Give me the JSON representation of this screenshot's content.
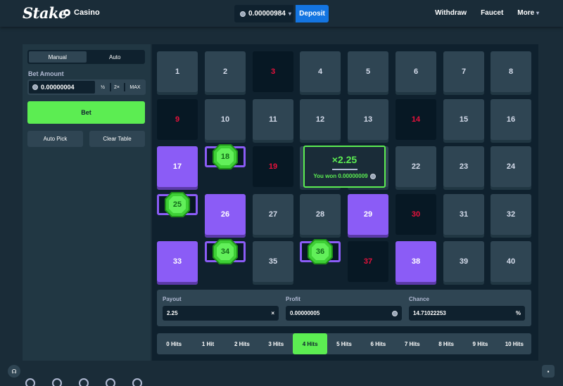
{
  "header": {
    "logo": "Stake",
    "section": "Casino",
    "balance": "0.00000984",
    "deposit": "Deposit",
    "nav": [
      "Withdraw",
      "Faucet",
      "More"
    ]
  },
  "sidebar": {
    "modes": [
      "Manual",
      "Auto"
    ],
    "active_mode": "Manual",
    "bet_label": "Bet Amount",
    "bet_value": "0.00000004",
    "half": "½",
    "double": "2×",
    "max": "MAX",
    "bet_button": "Bet",
    "auto_pick": "Auto Pick",
    "clear_table": "Clear Table"
  },
  "board": {
    "picked": [
      17,
      18,
      25,
      26,
      29,
      33,
      34,
      36,
      38
    ],
    "hits": [
      18,
      25,
      34,
      36
    ],
    "misses": [
      3,
      9,
      14,
      19,
      30,
      37
    ]
  },
  "popup": {
    "multiplier": "×2.25",
    "won": "You won 0.00000009"
  },
  "stats": {
    "payout_label": "Payout",
    "payout_value": "2.25",
    "payout_suffix": "×",
    "profit_label": "Profit",
    "profit_value": "0.00000005",
    "chance_label": "Chance",
    "chance_value": "14.71022253",
    "chance_suffix": "%"
  },
  "hits_bar": {
    "items": [
      "0 Hits",
      "1 Hit",
      "2 Hits",
      "3 Hits",
      "4 Hits",
      "5 Hits",
      "6 Hits",
      "7 Hits",
      "8 Hits",
      "9 Hits",
      "10 Hits"
    ],
    "active": "4 Hits"
  },
  "colors": {
    "accent_green": "#5ced52",
    "purple": "#8b5cf6",
    "deposit_blue": "#1475e1",
    "miss_red": "#e9113c"
  },
  "icons": {
    "section": "casino-icon",
    "coin": "coin-icon",
    "gem": "gem-icon",
    "support": "headset-icon",
    "chat": "chat-icon"
  }
}
